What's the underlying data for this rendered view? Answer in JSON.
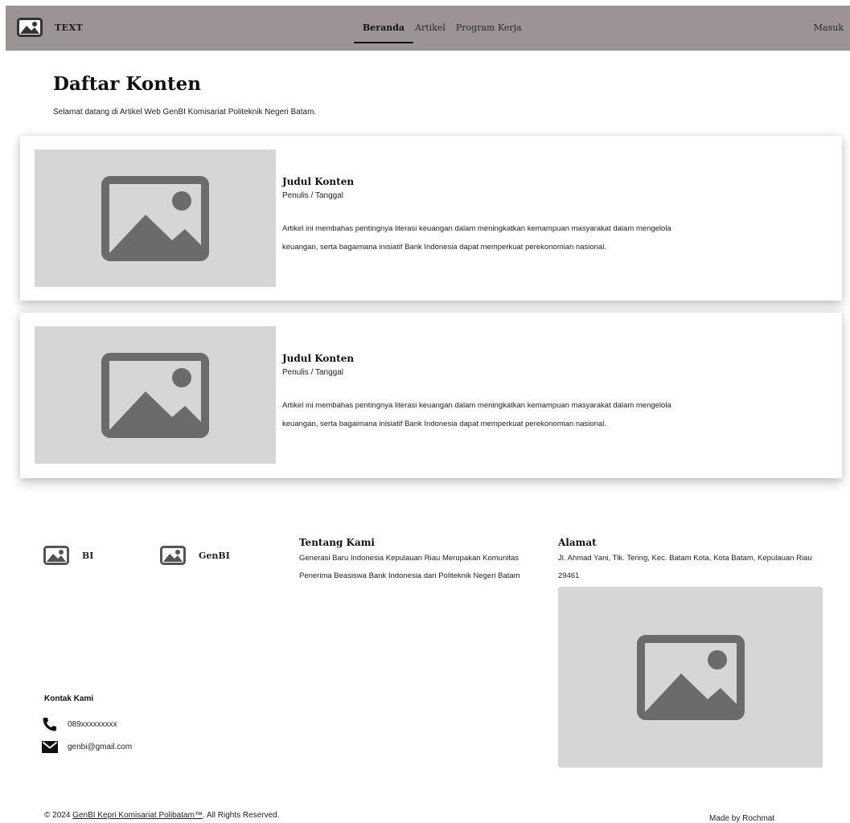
{
  "navbar": {
    "brand": "TEXT",
    "links": [
      {
        "label": "Beranda"
      },
      {
        "label": "Artikel"
      },
      {
        "label": "Program Kerja"
      }
    ],
    "login": "Masuk"
  },
  "main": {
    "title": "Daftar Konten",
    "subtitle": "Selamat datang di Artikel Web GenBI Komisariat Politeknik Negeri Batam.",
    "articles": [
      {
        "title": "Judul Konten",
        "meta": "Penulis / Tanggal",
        "description": "Artikel ini membahas pentingnya literasi keuangan dalam meningkatkan kemampuan masyarakat dalam mengelola keuangan, serta bagaimana inisiatif Bank Indonesia dapat memperkuat perekonomian nasional."
      },
      {
        "title": "Judul Konten",
        "meta": "Penulis / Tanggal",
        "description": "Artikel ini membahas pentingnya literasi keuangan dalam meningkatkan kemampuan masyarakat dalam mengelola keuangan, serta bagaimana inisiatif Bank Indonesia dapat memperkuat perekonomian nasional."
      }
    ]
  },
  "footer": {
    "logos": [
      {
        "label": "BI"
      },
      {
        "label": "GenBI"
      }
    ],
    "about": {
      "title": "Tentang Kami",
      "text": "Generasi Baru Indonesia Kepulauan Riau Merupakan Komunitas Penerima Beasiswa Bank Indonesia dari Politeknik Negeri Batam"
    },
    "address": {
      "title": "Alamat",
      "text": "Jl. Ahmad Yani, Tlk. Tering, Kec. Batam Kota, Kota Batam, Kepulauan Riau 29461"
    },
    "contact": {
      "title": "Kontak Kami",
      "phone": "089xxxxxxxxx",
      "email": "genbi@gmail.com"
    },
    "copyright": {
      "prefix": "© 2024 ",
      "link": "GenBI Kepri Komisariat Polibatam™",
      "suffix": ". All Rights Reserved."
    },
    "made_by": "Made by Rochmat"
  },
  "colors": {
    "navbar_bg": "#9c9494",
    "placeholder_bg": "#d6d6d6",
    "placeholder_icon": "#6b6b6b"
  }
}
